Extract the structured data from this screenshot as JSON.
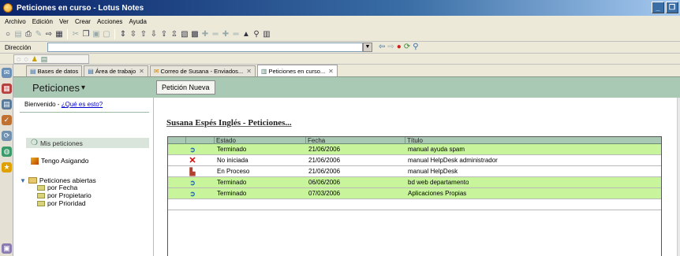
{
  "window": {
    "title": "Peticiones en curso - Lotus Notes",
    "controls": {
      "minimize": "_",
      "restore": "❐"
    }
  },
  "menu": [
    "Archivo",
    "Edición",
    "Ver",
    "Crear",
    "Acciones",
    "Ayuda"
  ],
  "address": {
    "label": "Dirección",
    "value": ""
  },
  "tabs": [
    {
      "label": "Bases de datos",
      "icon": "databases-icon",
      "active": false
    },
    {
      "label": "Área de trabajo",
      "icon": "workspace-icon",
      "active": false
    },
    {
      "label": "Correo de Susana - Enviados...",
      "icon": "mail-icon",
      "active": false
    },
    {
      "label": "Peticiones en curso...",
      "icon": "view-icon",
      "active": true
    }
  ],
  "nav": {
    "title": "Peticiones",
    "title_caret": "▾",
    "welcome_text": "Bienvenido - ",
    "welcome_link": "¿Qué es esto?",
    "items": [
      {
        "label": "Mis peticiones",
        "icon": "speech-bubble-icon"
      },
      {
        "label": "Tengo Asigando",
        "icon": "flag-icon"
      }
    ],
    "open_requests": {
      "label": "Peticiones abiertas",
      "children": [
        "por Fecha",
        "por Propietario",
        "por Prioridad"
      ]
    }
  },
  "toolbar": {
    "new_request_label": "Petición Nueva"
  },
  "view": {
    "title": "Susana Espés Inglés - Peticiones...",
    "columns": [
      "Estado",
      "Fecha",
      "Título"
    ],
    "rows": [
      {
        "icon": "arrow-icon",
        "estado": "Terminado",
        "fecha": "21/06/2006",
        "titulo": "manual ayuda spam",
        "highlight": true
      },
      {
        "icon": "x-icon",
        "estado": "No iniciada",
        "fecha": "21/06/2006",
        "titulo": "manual HelpDesk administrador",
        "highlight": false
      },
      {
        "icon": "in-progress-icon",
        "estado": "En Proceso",
        "fecha": "21/06/2006",
        "titulo": "manual HelpDesk",
        "highlight": false
      },
      {
        "icon": "arrow-icon",
        "estado": "Terminado",
        "fecha": "06/06/2006",
        "titulo": "bd web departamento",
        "highlight": true
      },
      {
        "icon": "arrow-icon",
        "estado": "Terminado",
        "fecha": "07/03/2006",
        "titulo": "Aplicaciones Propias",
        "highlight": true
      }
    ]
  },
  "colors": {
    "header_green": "#a9c9b4",
    "row_green": "#c8f59c",
    "titlebar_blue": "#0a246a"
  }
}
